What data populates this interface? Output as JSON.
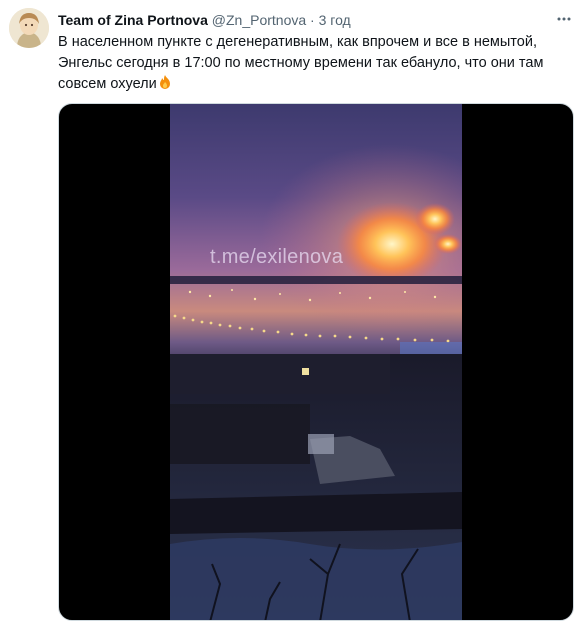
{
  "tweet": {
    "display_name": "Team of Zina Portnova",
    "handle": "@Zn_Portnova",
    "separator": "·",
    "time": "3 год",
    "text": "В населенном пункте с дегенеративным, как впрочем и все в немытой, Энгельс сегодня в 17:00 по местному времени так ебануло, что они там совсем охуели",
    "emoji": "fire-icon",
    "more_icon": "more-icon"
  },
  "media": {
    "watermark": "t.me/exilenova"
  }
}
